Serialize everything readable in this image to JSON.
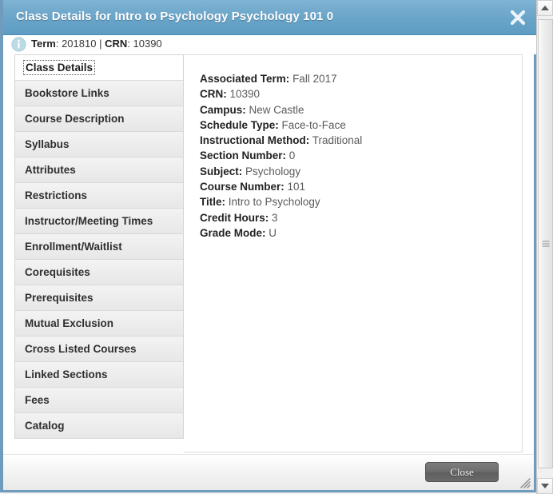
{
  "dialog": {
    "title": "Class Details for Intro to Psychology Psychology 101 0",
    "close_icon": "close-x-icon",
    "accent_color": "#6aa5c9",
    "border_color": "#6f9cbd"
  },
  "term_strip": {
    "info_icon": "info-circle-icon",
    "term_label": "Term",
    "term_value": "201810",
    "separator": "|",
    "crn_label": "CRN",
    "crn_value": "10390"
  },
  "tabs": [
    {
      "label": "Class Details",
      "selected": true
    },
    {
      "label": "Bookstore Links",
      "selected": false
    },
    {
      "label": "Course Description",
      "selected": false
    },
    {
      "label": "Syllabus",
      "selected": false
    },
    {
      "label": "Attributes",
      "selected": false
    },
    {
      "label": "Restrictions",
      "selected": false
    },
    {
      "label": "Instructor/Meeting Times",
      "selected": false
    },
    {
      "label": "Enrollment/Waitlist",
      "selected": false
    },
    {
      "label": "Corequisites",
      "selected": false
    },
    {
      "label": "Prerequisites",
      "selected": false
    },
    {
      "label": "Mutual Exclusion",
      "selected": false
    },
    {
      "label": "Cross Listed Courses",
      "selected": false
    },
    {
      "label": "Linked Sections",
      "selected": false
    },
    {
      "label": "Fees",
      "selected": false
    },
    {
      "label": "Catalog",
      "selected": false
    }
  ],
  "details": [
    {
      "label": "Associated Term:",
      "value": "Fall 2017"
    },
    {
      "label": "CRN:",
      "value": "10390"
    },
    {
      "label": "Campus:",
      "value": "New Castle"
    },
    {
      "label": "Schedule Type:",
      "value": "Face-to-Face"
    },
    {
      "label": "Instructional Method:",
      "value": "Traditional"
    },
    {
      "label": "Section Number:",
      "value": "0"
    },
    {
      "label": "Subject:",
      "value": "Psychology"
    },
    {
      "label": "Course Number:",
      "value": "101"
    },
    {
      "label": "Title:",
      "value": "Intro to Psychology"
    },
    {
      "label": "Credit Hours:",
      "value": "3"
    },
    {
      "label": "Grade Mode:",
      "value": "U"
    }
  ],
  "footer": {
    "close_label": "Close",
    "resize_grip_icon": "resize-grip-icon"
  },
  "scrollbar": {
    "up_icon": "scroll-up-arrow-icon",
    "down_icon": "scroll-down-arrow-icon",
    "thumb_icon": "scrollbar-thumb-grip-icon"
  }
}
